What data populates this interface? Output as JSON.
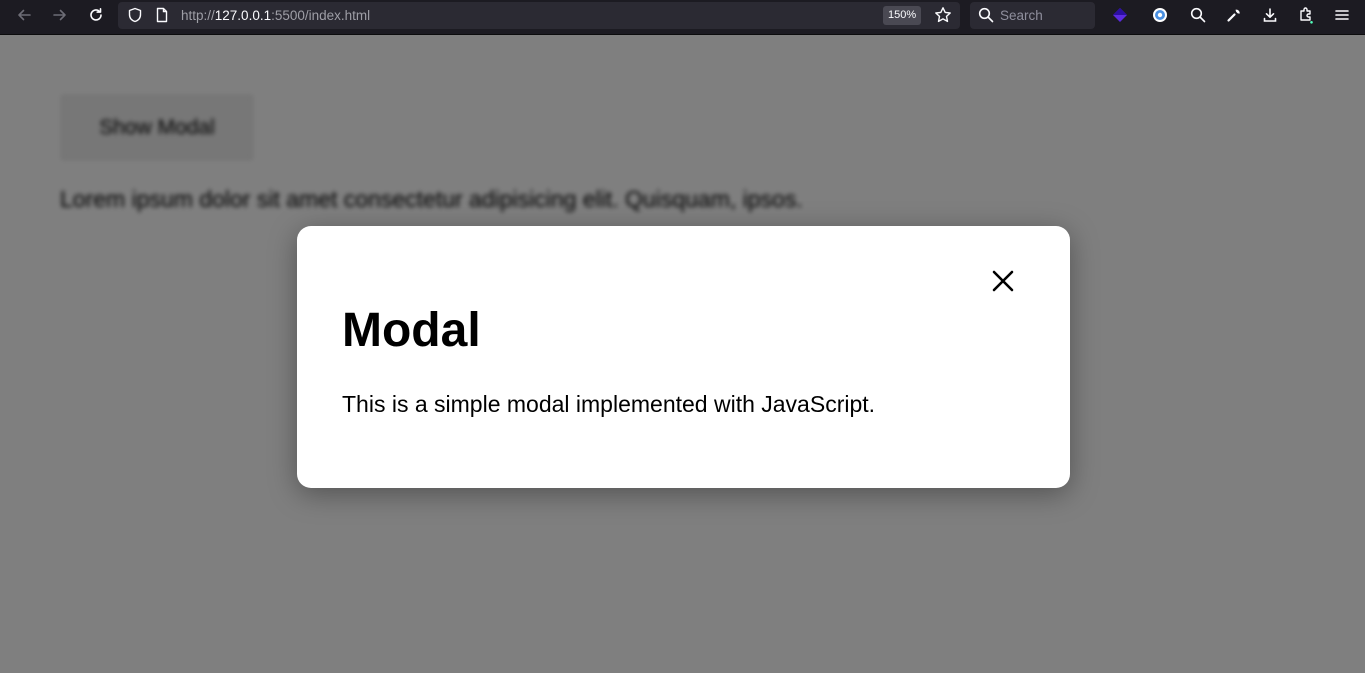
{
  "browser": {
    "url_scheme": "http://",
    "url_host": "127.0.0.1",
    "url_rest": ":5500/index.html",
    "zoom": "150%",
    "search_placeholder": "Search",
    "icons": [
      "back-icon",
      "forward-icon",
      "reload-icon",
      "shield-icon",
      "page-icon",
      "bookmark-star-icon",
      "search-icon",
      "extension-diamond-icon",
      "extension-circle-icon",
      "magnifier-icon",
      "wrench-icon",
      "download-icon",
      "extensions-icon",
      "menu-icon"
    ]
  },
  "page": {
    "show_modal_label": "Show Modal",
    "lorem_text": "Lorem ipsum dolor sit amet consectetur adipisicing elit. Quisquam, ipsos."
  },
  "modal": {
    "close_glyph": "×",
    "title": "Modal",
    "text": "This is a simple modal implemented with JavaScript."
  },
  "colors": {
    "toolbar_bg": "#1c1b22",
    "urlbar_bg": "#2b2a33",
    "overlay": "rgba(0,0,0,0.5)",
    "modal_bg": "#ffffff"
  }
}
